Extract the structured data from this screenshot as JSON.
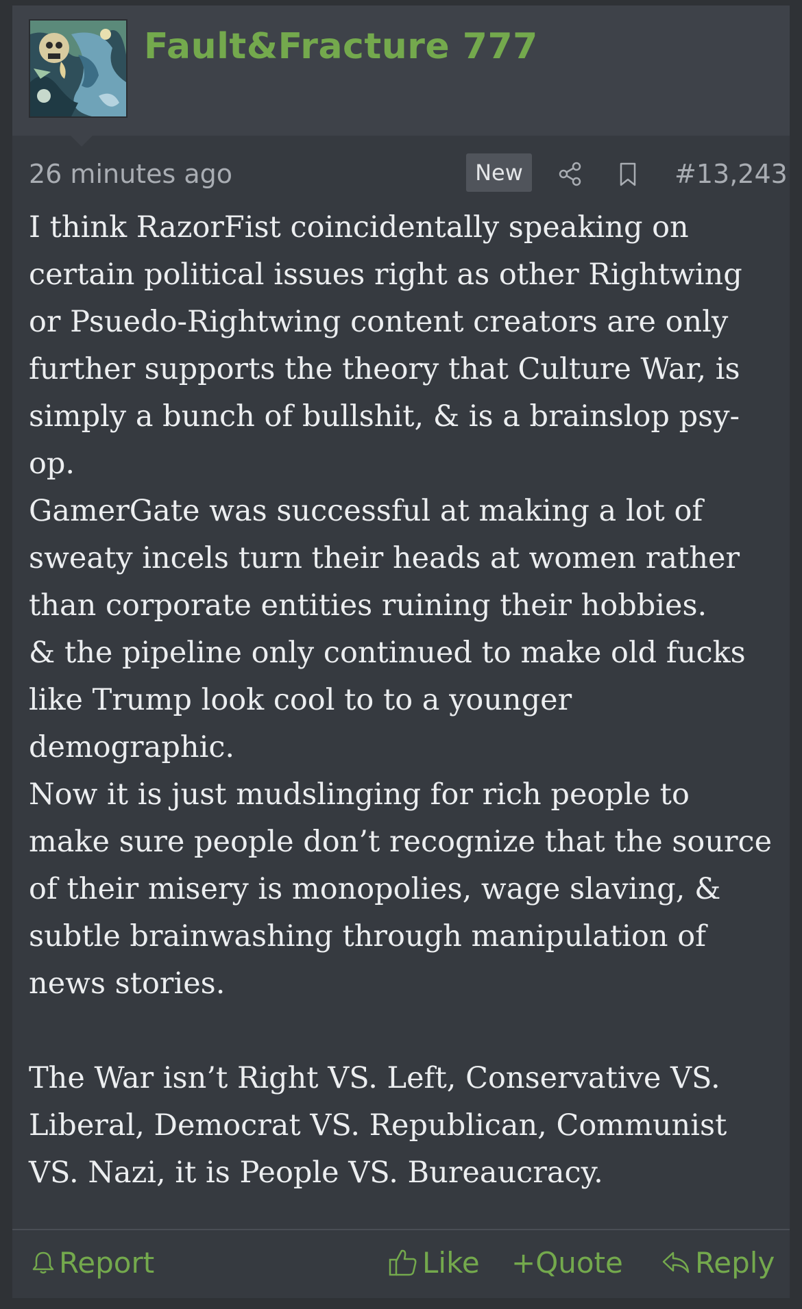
{
  "post": {
    "username": "Fault&Fracture 777",
    "timestamp": "26 minutes ago",
    "badge": "New",
    "post_number": "#13,243",
    "icons": {
      "avatar": "avatar-image",
      "share": "share-icon",
      "bookmark": "bookmark-icon"
    },
    "body": {
      "p1": "I think RazorFist coincidentally speaking on certain political issues right as other Rightwing or Psuedo-Rightwing content creators are only further supports the theory that Culture War, is simply a bunch of bullshit, & is a brainslop psy-op.",
      "p2": "GamerGate was successful at making a lot of sweaty incels turn their heads at women rather than corporate entities ruining their hobbies.",
      "p3": "& the pipeline only continued to make old fucks like Trump look cool to to a younger demographic.",
      "p4": "Now it is just mudslinging for rich people to make sure people don’t recognize that the source of their misery is monopolies, wage slaving, & subtle brainwashing through manipulation of news stories.",
      "p5": "The War isn’t Right VS. Left, Conservative VS. Liberal, Democrat VS. Republican, Communist VS. Nazi, it is People VS. Bureaucracy."
    },
    "actions": {
      "report": "Report",
      "like": "Like",
      "quote": "+Quote",
      "reply": "Reply"
    }
  },
  "colors": {
    "page_background": "#2f3236",
    "post_background": "#363a40",
    "header_background": "#3e4249",
    "accent_green": "#74a94d",
    "text_primary": "#eceef0",
    "text_muted": "#a9adb3",
    "badge_background": "#50545b"
  }
}
